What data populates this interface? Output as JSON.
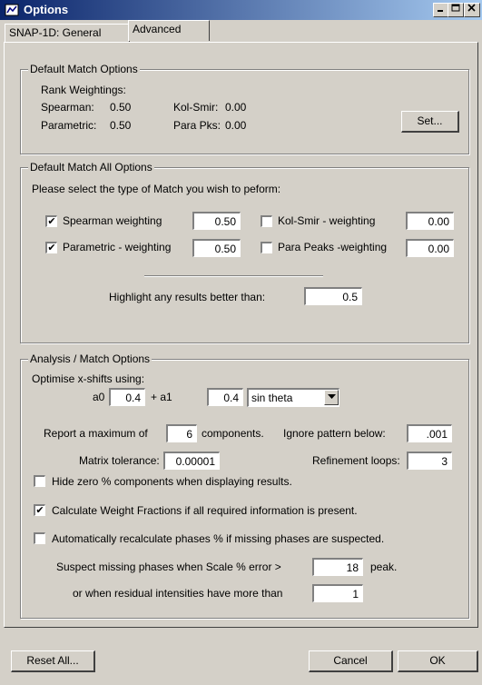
{
  "window": {
    "title": "Options"
  },
  "tabs": [
    {
      "label": "SNAP-1D: General"
    },
    {
      "label": "Advanced"
    }
  ],
  "default_match": {
    "legend": "Default Match Options",
    "rank_weightings": "Rank Weightings:",
    "spearman_label": "Spearman:",
    "spearman_value": "0.50",
    "kolsmir_label": "Kol-Smir:",
    "kolsmir_value": "0.00",
    "parametric_label": "Parametric:",
    "parametric_value": "0.50",
    "parapks_label": "Para Pks:",
    "parapks_value": "0.00",
    "set_button": "Set..."
  },
  "match_all": {
    "legend": "Default Match All Options",
    "prompt": "Please select the type of Match you wish to peform:",
    "spearman_label": "Spearman weighting",
    "spearman_checked": true,
    "spearman_value": "0.50",
    "kolsmir_label": "Kol-Smir - weighting",
    "kolsmir_checked": false,
    "kolsmir_value": "0.00",
    "parametric_label": "Parametric - weighting",
    "parametric_checked": true,
    "parametric_value": "0.50",
    "parapeaks_label": "Para Peaks -weighting",
    "parapeaks_checked": false,
    "parapeaks_value": "0.00",
    "highlight_label": "Highlight any results   better than:",
    "highlight_value": "0.5"
  },
  "analysis": {
    "legend": "Analysis / Match Options",
    "optimise_label": "Optimise x-shifts using:",
    "a0_label": "a0",
    "a0_value": "0.4",
    "a1_label": "+ a1",
    "a1_value": "0.4",
    "function_value": "sin theta",
    "report_label": "Report a maximum of",
    "report_value": "6",
    "components_label": "components.",
    "ignore_label": "Ignore pattern below:",
    "ignore_value": ".001",
    "matrix_label": "Matrix tolerance:",
    "matrix_value": "0.00001",
    "refine_label": "Refinement loops:",
    "refine_value": "3",
    "hide_zero_label": "Hide zero % components when displaying results.",
    "hide_zero_checked": false,
    "calc_wf_label": "Calculate Weight Fractions if all required information is present.",
    "calc_wf_checked": true,
    "auto_recalc_label": "Automatically recalculate phases % if missing phases are suspected.",
    "auto_recalc_checked": false,
    "suspect_label": "Suspect missing phases when Scale % error >",
    "suspect_value": "18",
    "peak_label": "peak.",
    "residual_label": "or when residual intensities have more than",
    "residual_value": "1"
  },
  "buttons": {
    "reset": "Reset All...",
    "cancel": "Cancel",
    "ok": "OK"
  },
  "check_glyph": "✔"
}
